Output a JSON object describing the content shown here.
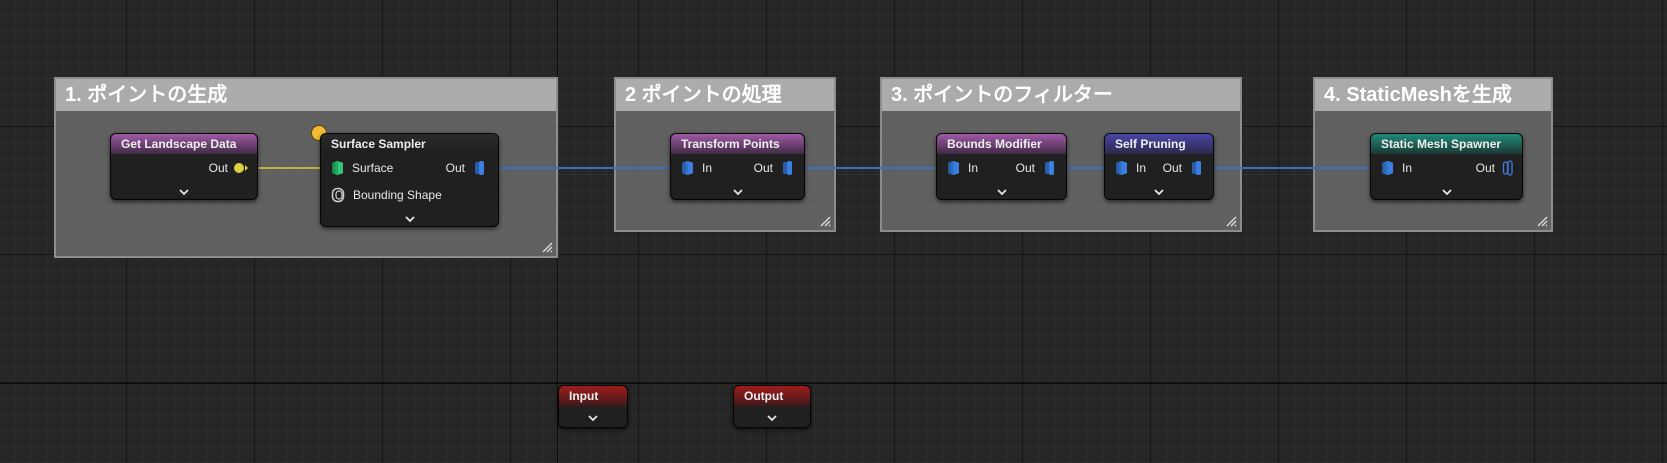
{
  "comments": [
    {
      "title": "1. ポイントの生成"
    },
    {
      "title": "2 ポイントの処理"
    },
    {
      "title": "3. ポイントのフィルター"
    },
    {
      "title": "4. StaticMeshを生成"
    }
  ],
  "nodes": {
    "get_landscape_data": {
      "title": "Get Landscape Data",
      "out_label": "Out"
    },
    "surface_sampler": {
      "title": "Surface Sampler",
      "surface_label": "Surface",
      "bounding_label": "Bounding Shape",
      "out_label": "Out"
    },
    "transform_points": {
      "title": "Transform Points",
      "in_label": "In",
      "out_label": "Out"
    },
    "bounds_modifier": {
      "title": "Bounds Modifier",
      "in_label": "In",
      "out_label": "Out"
    },
    "self_pruning": {
      "title": "Self Pruning",
      "in_label": "In",
      "out_label": "Out"
    },
    "static_mesh_spawner": {
      "title": "Static Mesh Spawner",
      "in_label": "In",
      "out_label": "Out"
    },
    "input": {
      "title": "Input"
    },
    "output": {
      "title": "Output"
    }
  },
  "icons": {
    "spatial_pin": "stacked-blue-pin-icon",
    "surface_pin": "stacked-green-pin-icon",
    "landscape_pin": "yellow-dot-pin-icon",
    "bounding_pin": "outline-pin-icon",
    "expand": "chevron-down-icon",
    "resize": "resize-corner-icon"
  },
  "colors": {
    "background": "#262626",
    "wire_spatial": "#3a6fc0",
    "wire_landscape": "#c4b23a",
    "header_settings": "#a05aa6",
    "header_filter": "#4b46a8",
    "header_spawner": "#1f8a78",
    "header_io": "#a01c1c",
    "debug_marker": "#f2bb33"
  }
}
